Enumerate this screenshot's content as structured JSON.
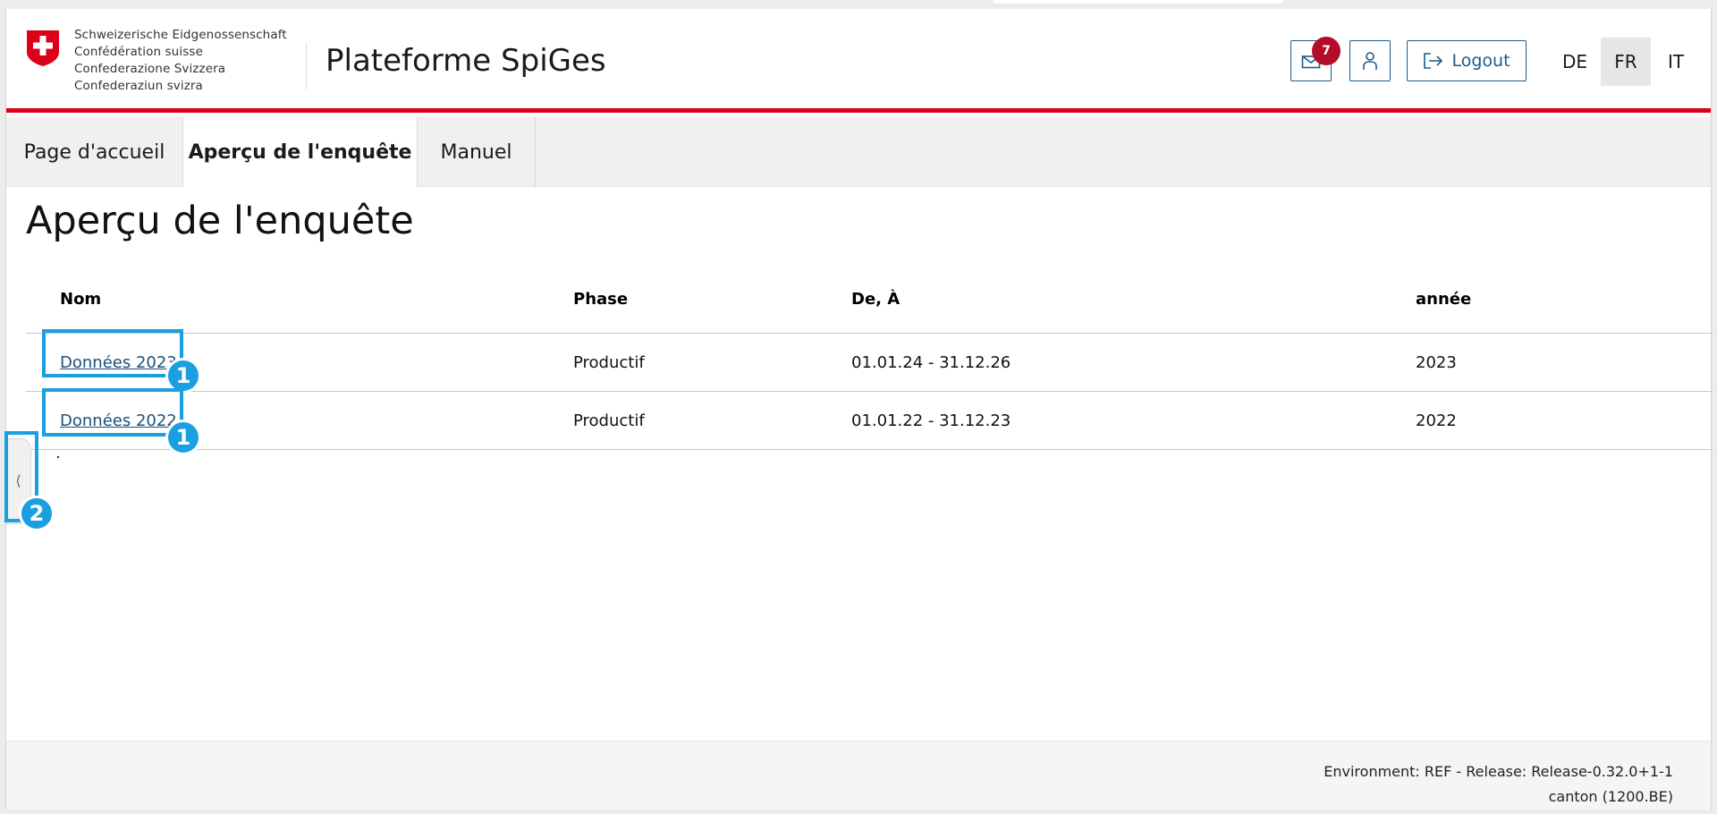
{
  "header": {
    "confederation_lines": [
      "Schweizerische Eidgenossenschaft",
      "Confédération suisse",
      "Confederazione Svizzera",
      "Confederaziun svizra"
    ],
    "app_title": "Plateforme SpiGes",
    "notification_count": "7",
    "logout_label": "Logout",
    "languages": [
      "DE",
      "FR",
      "IT"
    ],
    "active_language": "FR"
  },
  "nav": {
    "tabs": [
      {
        "label": "Page d'accueil"
      },
      {
        "label": "Aperçu de l'enquête"
      },
      {
        "label": "Manuel"
      }
    ],
    "active_tab": "Aperçu de l'enquête"
  },
  "main": {
    "title": "Aperçu de l'enquête",
    "table": {
      "columns": [
        "Nom",
        "Phase",
        "De, À",
        "année"
      ],
      "rows": [
        {
          "name": "Données 2023",
          "phase": "Productif",
          "range": "01.01.24 - 31.12.26",
          "year": "2023"
        },
        {
          "name": "Données 2022",
          "phase": "Productif",
          "range": "01.01.22 - 31.12.23",
          "year": "2022"
        }
      ]
    }
  },
  "annotations": {
    "marker_1": "1",
    "marker_2": "2"
  },
  "footer": {
    "line1": "Environment: REF - Release: Release-0.32.0+1-1",
    "line2": "canton (1200.BE)"
  },
  "colors": {
    "accent_red": "#dc0018",
    "link_blue": "#1c4f7a",
    "highlight_blue": "#1aa0e0",
    "badge_red": "#b30d2a"
  }
}
